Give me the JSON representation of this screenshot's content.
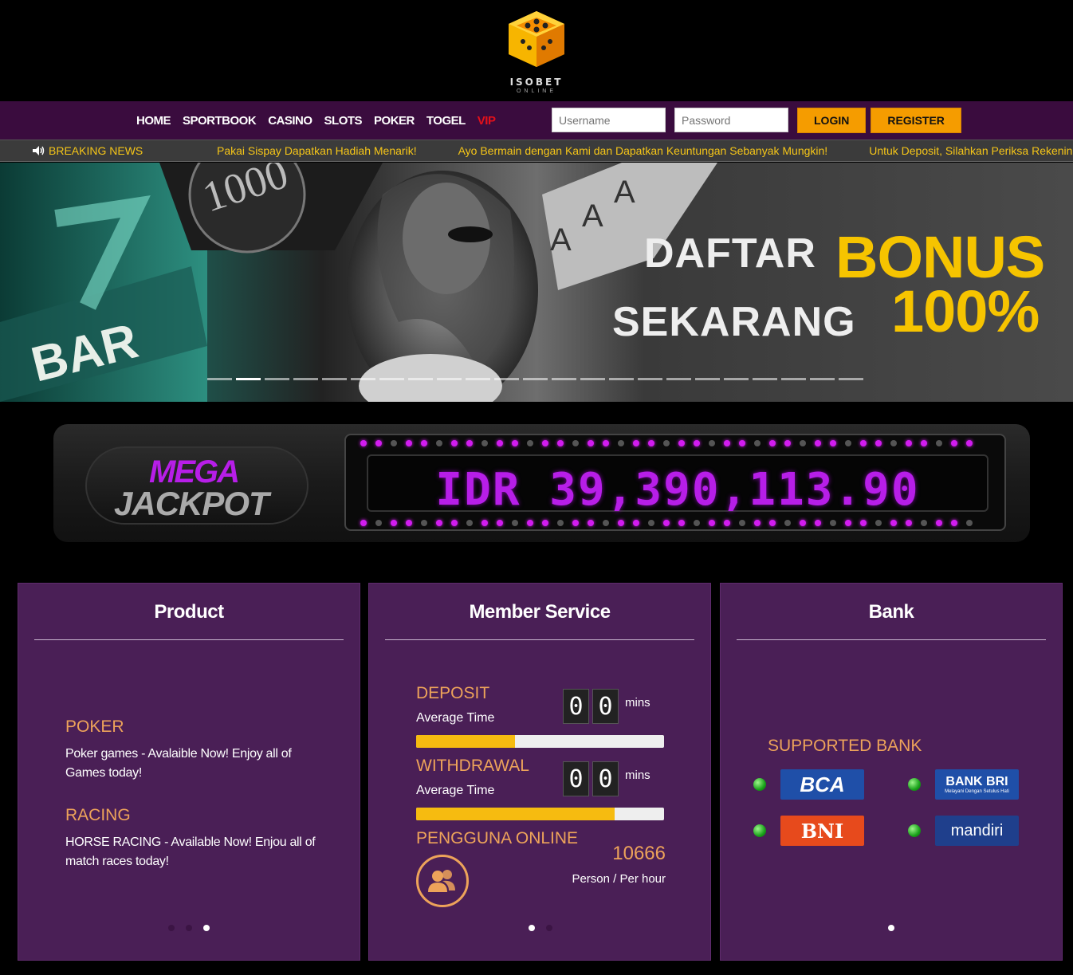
{
  "logo": {
    "name": "ISOBET",
    "sub": "ONLINE"
  },
  "nav": {
    "items": [
      "HOME",
      "SPORTBOOK",
      "CASINO",
      "SLOTS",
      "POKER",
      "TOGEL",
      "VIP"
    ],
    "username_placeholder": "Username",
    "password_placeholder": "Password",
    "login_label": "LOGIN",
    "register_label": "REGISTER"
  },
  "news": {
    "label": "BREAKING NEWS",
    "items": [
      "Pakai Sispay Dapatkan Hadiah Menarik!",
      "Ayo Bermain dengan Kami dan Dapatkan Keuntungan Sebanyak Mungkin!",
      "Untuk Deposit, Silahkan Periksa Rekening"
    ]
  },
  "banner": {
    "line1": "DAFTAR",
    "line2": "SEKARANG",
    "bonus": "BONUS",
    "percent": "100%",
    "chip": "1000",
    "slot_word": "BAR",
    "card_letter": "A",
    "slide_count": 23,
    "active_slide": 1
  },
  "jackpot": {
    "mega": "MEGA",
    "jackpot": "JACKPOT",
    "value": "IDR 39,390,113.90"
  },
  "product": {
    "title": "Product",
    "items": [
      {
        "head": "POKER",
        "desc": "Poker games - Avalaible Now! Enjoy all of Games today!"
      },
      {
        "head": "RACING",
        "desc": "HORSE RACING - Available Now! Enjou all of match races today!"
      }
    ],
    "dots": 3,
    "active_dot": 2
  },
  "member_service": {
    "title": "Member Service",
    "deposit": {
      "label": "DEPOSIT",
      "sub": "Average Time",
      "digits": [
        "0",
        "0"
      ],
      "unit": "mins",
      "progress": 0.4
    },
    "withdrawal": {
      "label": "WITHDRAWAL",
      "sub": "Average Time",
      "digits": [
        "0",
        "0"
      ],
      "unit": "mins",
      "progress": 0.8
    },
    "online": {
      "label": "PENGGUNA ONLINE",
      "count": "10666",
      "sub": "Person / Per hour"
    },
    "dots": 2,
    "active_dot": 0
  },
  "bank": {
    "title": "Bank",
    "supported_label": "SUPPORTED BANK",
    "banks": [
      {
        "name": "BCA",
        "status": "online"
      },
      {
        "name": "BANK BRI",
        "tagline": "Melayani Dengan Setulus Hati",
        "status": "online"
      },
      {
        "name": "BNI",
        "status": "online"
      },
      {
        "name": "mandiri",
        "status": "online"
      }
    ],
    "dots": 1,
    "active_dot": 0
  },
  "colors": {
    "nav_bg": "#3a0c3e",
    "panel_bg": "#4a1f56",
    "accent_orange": "#eda35a",
    "button_orange": "#f59c00",
    "jackpot_purple": "#b71ee8",
    "vip_red": "#e4101a"
  }
}
